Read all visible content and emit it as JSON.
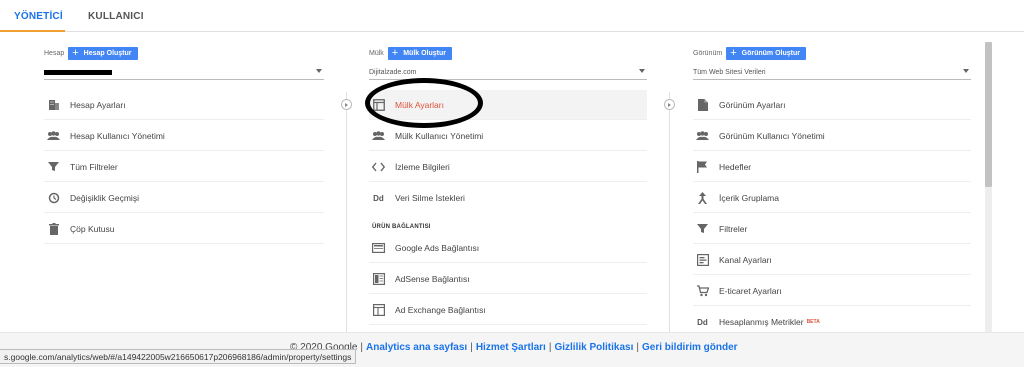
{
  "tabs": [
    {
      "label": "YÖNETİCİ",
      "active": true
    },
    {
      "label": "KULLANICI",
      "active": false
    }
  ],
  "columns": {
    "account": {
      "label": "Hesap",
      "create_button": "Hesap Oluştur",
      "items": [
        {
          "label": "Hesap Ayarları",
          "icon": "building-icon"
        },
        {
          "label": "Hesap Kullanıcı Yönetimi",
          "icon": "people-icon"
        },
        {
          "label": "Tüm Filtreler",
          "icon": "filter-icon"
        },
        {
          "label": "Değişiklik Geçmişi",
          "icon": "history-icon"
        },
        {
          "label": "Çöp Kutusu",
          "icon": "trash-icon"
        }
      ]
    },
    "property": {
      "label": "Mülk",
      "create_button": "Mülk Oluştur",
      "selector_value": "Dijitalzade.com",
      "items": [
        {
          "label": "Mülk Ayarları",
          "icon": "property-settings-icon",
          "active": true
        },
        {
          "label": "Mülk Kullanıcı Yönetimi",
          "icon": "people-icon"
        },
        {
          "label": "İzleme Bilgileri",
          "icon": "code-icon"
        },
        {
          "label": "Veri Silme İstekleri",
          "icon": "dd-icon"
        }
      ],
      "section_title": "ÜRÜN BAĞLANTISI",
      "links": [
        {
          "label": "Google Ads Bağlantısı",
          "icon": "ads-icon"
        },
        {
          "label": "AdSense Bağlantısı",
          "icon": "adsense-icon"
        },
        {
          "label": "Ad Exchange Bağlantısı",
          "icon": "adexchange-icon"
        }
      ]
    },
    "view": {
      "label": "Görünüm",
      "create_button": "Görünüm Oluştur",
      "selector_value": "Tüm Web Sitesi Verileri",
      "items": [
        {
          "label": "Görünüm Ayarları",
          "icon": "document-icon"
        },
        {
          "label": "Görünüm Kullanıcı Yönetimi",
          "icon": "people-icon"
        },
        {
          "label": "Hedefler",
          "icon": "flag-icon"
        },
        {
          "label": "İçerik Gruplama",
          "icon": "grouping-icon"
        },
        {
          "label": "Filtreler",
          "icon": "filter-icon"
        },
        {
          "label": "Kanal Ayarları",
          "icon": "channel-icon"
        },
        {
          "label": "E-ticaret Ayarları",
          "icon": "cart-icon"
        },
        {
          "label": "Hesaplanmış Metrikler",
          "icon": "dd-icon",
          "badge": "BETA"
        }
      ]
    }
  },
  "footer": {
    "copyright": "© 2020 Google",
    "links": [
      "Analytics ana sayfası",
      "Hizmet Şartları",
      "Gizlilik Politikası",
      "Geri bildirim gönder"
    ]
  },
  "status_url": "s.google.com/analytics/web/#/a149422005w216650617p206968186/admin/property/settings",
  "colors": {
    "accent": "#1a73e8",
    "button": "#4285f4",
    "active_text": "#e0533d",
    "tab_underline": "#f0a030"
  }
}
